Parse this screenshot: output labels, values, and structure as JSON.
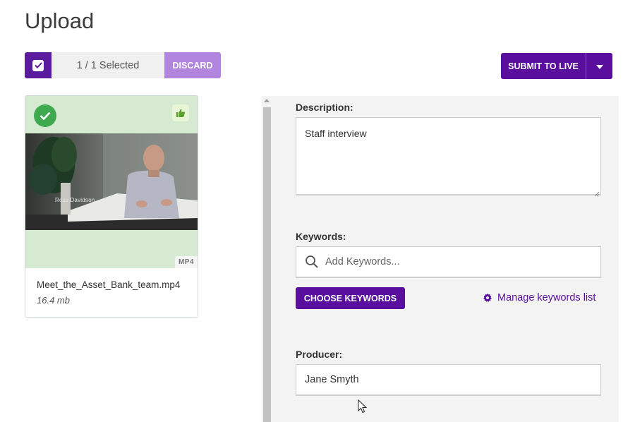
{
  "page": {
    "title": "Upload"
  },
  "selection": {
    "count_text": "1  / 1 Selected",
    "discard_label": "DISCARD"
  },
  "toolbar": {
    "submit_label": "SUBMIT TO LIVE"
  },
  "asset": {
    "file_name": "Meet_the_Asset_Bank_team.mp4",
    "file_size": "16.4 mb",
    "format_badge": "MP4",
    "video_caption_name": "Ross Davidson",
    "status_icon": "check-circle-icon",
    "approval_icon": "thumbs-up-icon"
  },
  "form": {
    "description": {
      "label": "Description:",
      "value": "Staff interview"
    },
    "keywords": {
      "label": "Keywords:",
      "placeholder": "Add Keywords...",
      "choose_label": "CHOOSE KEYWORDS",
      "manage_label": "Manage keywords list"
    },
    "producer": {
      "label": "Producer:",
      "value": "Jane Smyth"
    }
  },
  "colors": {
    "primary": "#5a0e9e",
    "discard": "#b184de",
    "success": "#3ea94f",
    "card_bg": "#d6e9d1"
  }
}
